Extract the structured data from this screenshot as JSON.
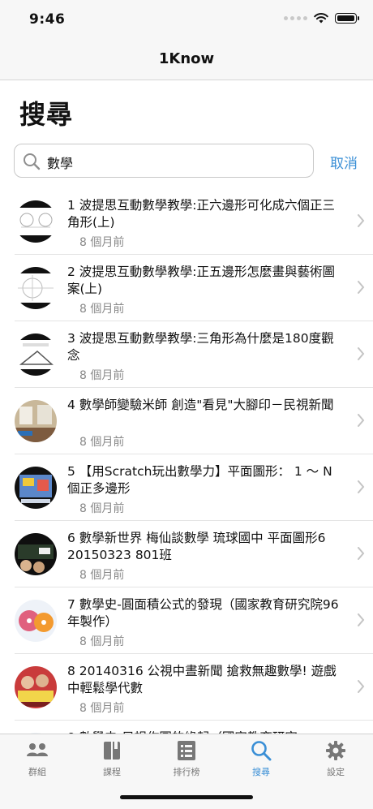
{
  "status": {
    "time": "9:46"
  },
  "nav": {
    "title": "1Know"
  },
  "page": {
    "title": "搜尋"
  },
  "search": {
    "value": "數學",
    "cancel_label": "取消"
  },
  "results": [
    {
      "title": "1 波提思互動數學教學:正六邊形可化成六個正三角形(上)",
      "time": "8 個月前"
    },
    {
      "title": "2 波提思互動數學教學:正五邊形怎麼畫與藝術圖案(上)",
      "time": "8 個月前"
    },
    {
      "title": "3 波提思互動數學教學:三角形為什麼是180度觀念",
      "time": "8 個月前"
    },
    {
      "title": "4 數學師變驗米師 創造\"看見\"大腳印－民視新聞",
      "time": "8 個月前"
    },
    {
      "title": "5 【用Scratch玩出數學力】平面圖形： 1 ～ N個正多邊形",
      "time": "8 個月前"
    },
    {
      "title": "6 數學新世界 梅仙談數學 琉球國中 平面圖形6 20150323 801班",
      "time": "8 個月前"
    },
    {
      "title": "7 數學史-圓面積公式的發現（國家教育研究院96年製作）",
      "time": "8 個月前"
    },
    {
      "title": "8 20140316 公視中晝新聞 搶救無趣數學! 遊戲中輕鬆學代數",
      "time": "8 個月前"
    },
    {
      "title": "9 數學史-尺規作圖的緣起（國家教育研究",
      "time": ""
    }
  ],
  "tabs": [
    {
      "label": "群組",
      "icon": "group-icon"
    },
    {
      "label": "課程",
      "icon": "book-icon"
    },
    {
      "label": "排行榜",
      "icon": "list-icon"
    },
    {
      "label": "搜尋",
      "icon": "search-icon",
      "active": true
    },
    {
      "label": "設定",
      "icon": "gear-icon"
    }
  ],
  "colors": {
    "accent": "#3a8fd6",
    "bar_bg": "#f7f7f7",
    "secondary_text": "#8a8a8a"
  }
}
